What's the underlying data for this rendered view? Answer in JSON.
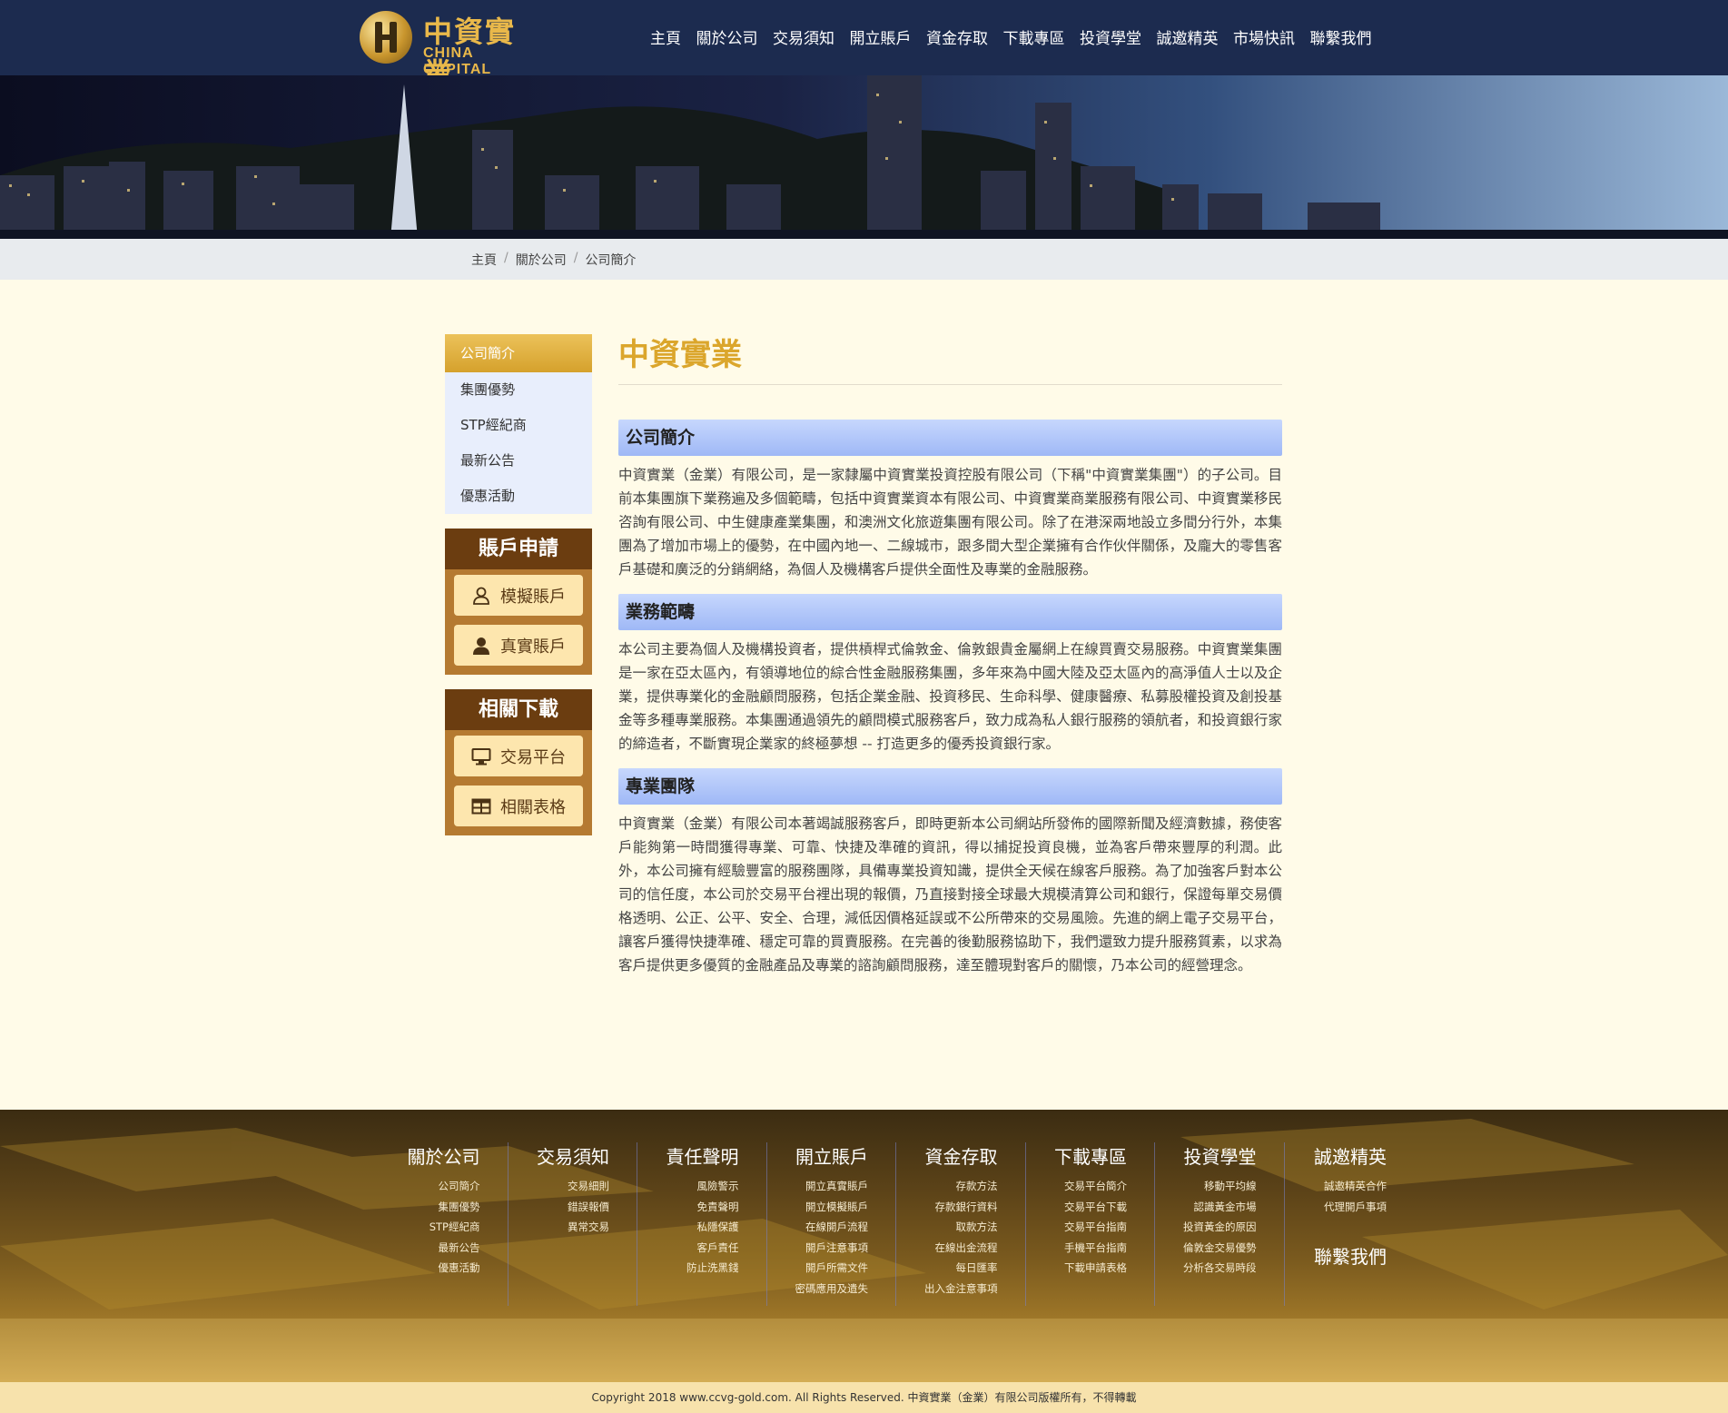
{
  "header": {
    "logo_cn": "中資實業",
    "logo_en": "CHINA CAPITAL",
    "nav": [
      "主頁",
      "關於公司",
      "交易須知",
      "開立賬戶",
      "資金存取",
      "下載專區",
      "投資學堂",
      "誠邀精英",
      "市場快訊",
      "聯繫我們"
    ]
  },
  "breadcrumb": [
    "主頁",
    "關於公司",
    "公司簡介"
  ],
  "sidebar": {
    "menu": [
      "公司簡介",
      "集團優勢",
      "STP經紀商",
      "最新公告",
      "優惠活動"
    ],
    "active_index": 0,
    "accounts": {
      "title": "賬戶申請",
      "buttons": [
        {
          "label": "模擬賬戶",
          "icon": "user-outline-icon"
        },
        {
          "label": "真實賬戶",
          "icon": "user-solid-icon"
        }
      ]
    },
    "downloads": {
      "title": "相關下載",
      "buttons": [
        {
          "label": "交易平台",
          "icon": "monitor-icon"
        },
        {
          "label": "相關表格",
          "icon": "table-icon"
        }
      ]
    }
  },
  "content": {
    "title": "中資實業",
    "sections": [
      {
        "heading": "公司簡介",
        "text": "中資實業（金業）有限公司，是一家隸屬中資實業投資控股有限公司（下稱\"中資實業集團\"）的子公司。目前本集團旗下業務遍及多個範疇，包括中資實業資本有限公司、中資實業商業服務有限公司、中資實業移民咨詢有限公司、中生健康產業集團，和澳洲文化旅遊集團有限公司。除了在港深兩地設立多間分行外，本集團為了增加市場上的優勢，在中國內地一、二線城市，跟多間大型企業擁有合作伙伴關係，及龐大的零售客戶基礎和廣泛的分銷網絡，為個人及機構客戶提供全面性及專業的金融服務。"
      },
      {
        "heading": "業務範疇",
        "text": "本公司主要為個人及機構投資者，提供槓桿式倫敦金、倫敦銀貴金屬網上在線買賣交易服務。中資實業集團是一家在亞太區內，有領導地位的綜合性金融服務集團，多年來為中國大陸及亞太區內的高淨值人士以及企業，提供專業化的金融顧問服務，包括企業金融、投資移民、生命科學、健康醫療、私募股權投資及創投基金等多種專業服務。本集團通過領先的顧問模式服務客戶，致力成為私人銀行服務的領航者，和投資銀行家的締造者，不斷實現企業家的終極夢想 -- 打造更多的優秀投資銀行家。"
      },
      {
        "heading": "專業團隊",
        "text": "中資實業（金業）有限公司本著竭誠服務客戶，即時更新本公司網站所發佈的國際新聞及經濟數據，務使客戶能夠第一時間獲得專業、可靠、快捷及準確的資訊，得以捕捉投資良機，並為客戶帶來豐厚的利潤。此外，本公司擁有經驗豐富的服務團隊，具備專業投資知識，提供全天候在線客戶服務。為了加強客戶對本公司的信任度，本公司於交易平台裡出現的報價，乃直接對接全球最大規模清算公司和銀行，保證每單交易價格透明、公正、公平、安全、合理，減低因價格延誤或不公所帶來的交易風險。先進的網上電子交易平台，讓客戶獲得快捷準確、穩定可靠的買賣服務。在完善的後勤服務協助下，我們還致力提升服務質素，以求為客戶提供更多優質的金融產品及專業的諮詢顧問服務，達至體現對客戶的關懷，乃本公司的經營理念。"
      }
    ]
  },
  "footer": {
    "columns": [
      {
        "title": "關於公司",
        "links": [
          "公司簡介",
          "集團優勢",
          "STP經紀商",
          "最新公告",
          "優惠活動"
        ]
      },
      {
        "title": "交易須知",
        "links": [
          "交易細則",
          "錯誤報價",
          "異常交易"
        ]
      },
      {
        "title": "責任聲明",
        "links": [
          "風險警示",
          "免責聲明",
          "私隱保護",
          "客戶責任",
          "防止洗黑錢"
        ]
      },
      {
        "title": "開立賬戶",
        "links": [
          "開立真實賬戶",
          "開立模擬賬戶",
          "在線開戶流程",
          "開戶注意事項",
          "開戶所需文件",
          "密碼應用及遺失"
        ]
      },
      {
        "title": "資金存取",
        "links": [
          "存款方法",
          "存款銀行資料",
          "取款方法",
          "在線出金流程",
          "每日匯率",
          "出入金注意事項"
        ]
      },
      {
        "title": "下載專區",
        "links": [
          "交易平台簡介",
          "交易平台下載",
          "交易平台指南",
          "手機平台指南",
          "下載申請表格"
        ]
      },
      {
        "title": "投資學堂",
        "links": [
          "移動平均線",
          "認識黃金市場",
          "投資黃金的原因",
          "倫敦金交易優勢",
          "分析各交易時段"
        ]
      },
      {
        "title": "誠邀精英",
        "links": [
          "誠邀精英合作",
          "代理開戶事項"
        ],
        "extra": "聯繫我們"
      }
    ],
    "copyright": "Copyright 2018 www.ccvg-gold.com. All Rights Reserved. 中資實業（金業）有限公司版權所有，不得轉載"
  },
  "colors": {
    "header_bg": "#1c2b4f",
    "accent_gold": "#dba62c",
    "section_blue": "#a9c0f8",
    "page_bg": "#fffbe8"
  }
}
